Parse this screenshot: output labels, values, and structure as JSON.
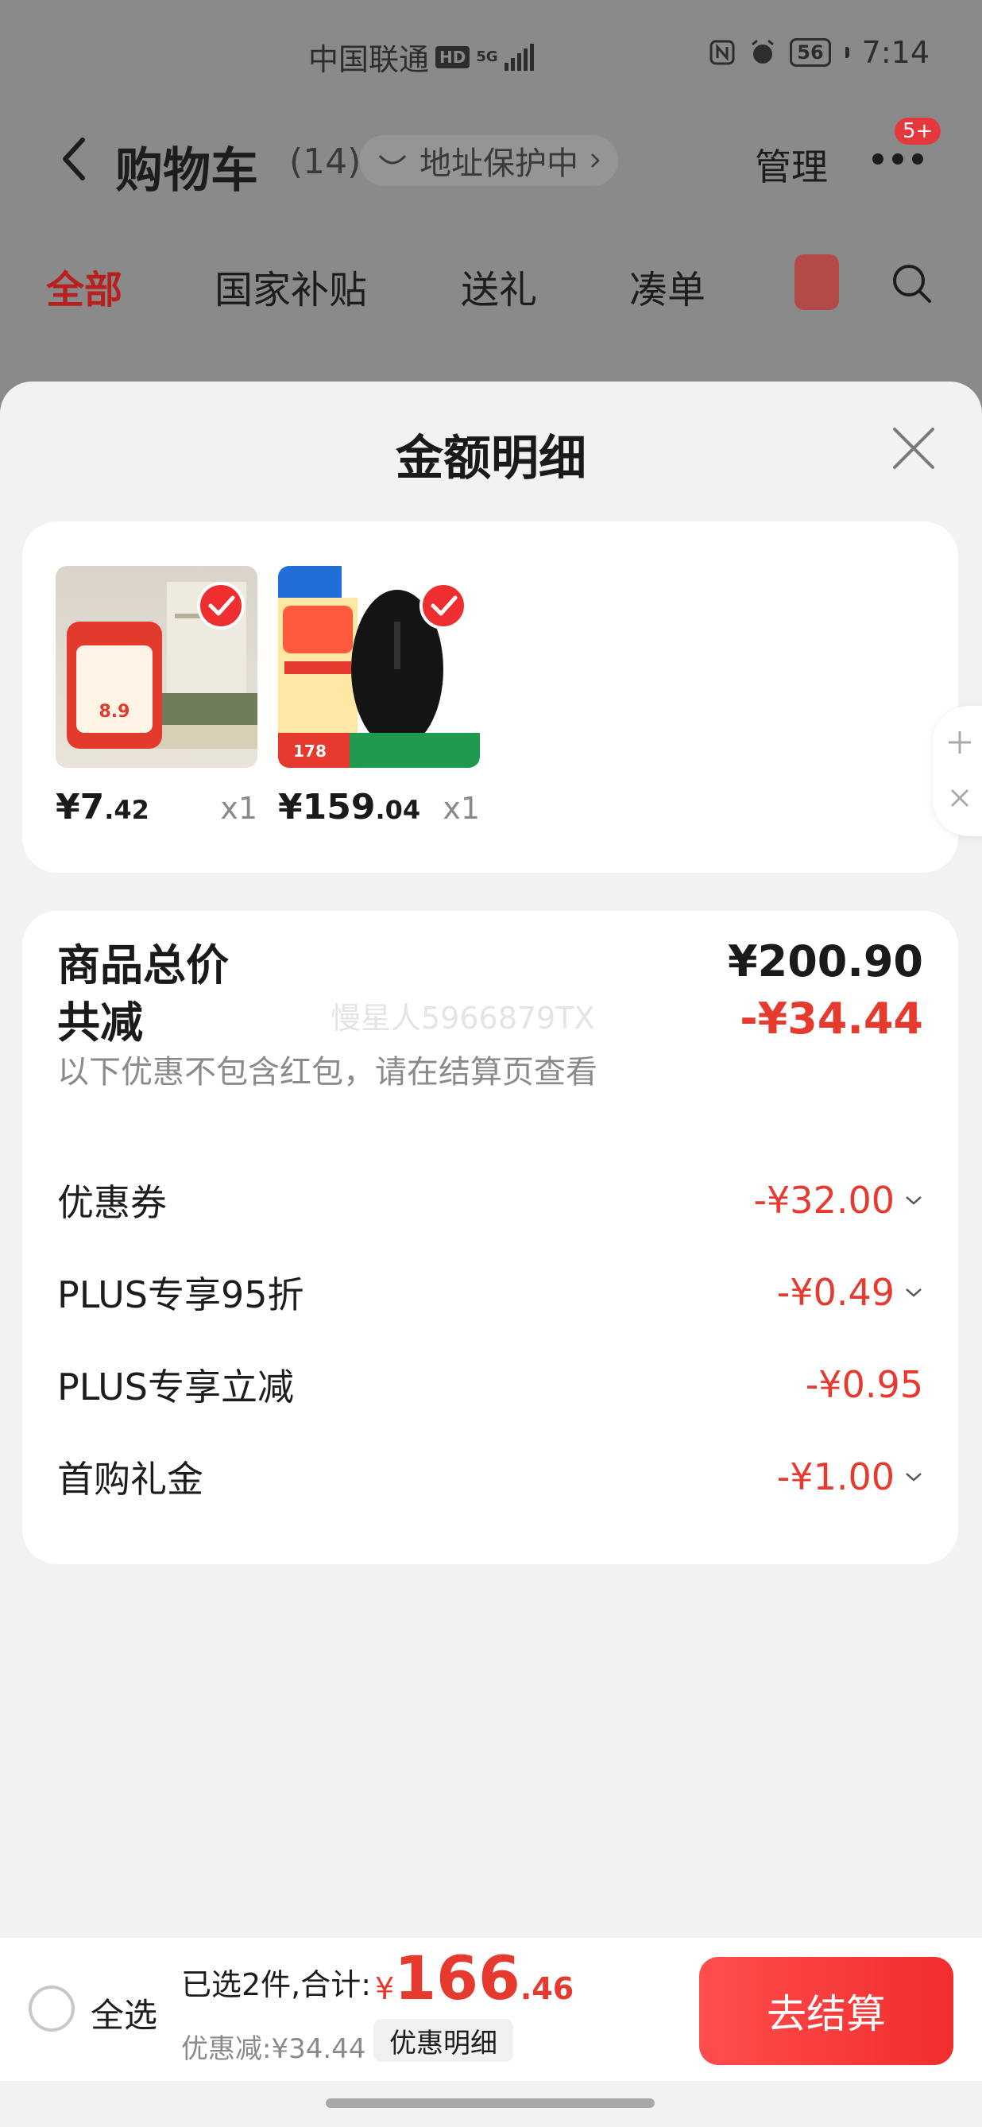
{
  "status_bar": {
    "carrier": "中国联通",
    "hd": "HD",
    "network": "5G",
    "battery": "56",
    "time": "7:14"
  },
  "nav": {
    "title": "购物车",
    "count": "(14)",
    "address_protect": "地址保护中",
    "manage": "管理",
    "more_badge": "5+"
  },
  "tabs": [
    {
      "label": "全部",
      "active": true
    },
    {
      "label": "国家补贴",
      "active": false
    },
    {
      "label": "送礼",
      "active": false
    },
    {
      "label": "凑单",
      "active": false
    }
  ],
  "sheet": {
    "title": "金额明细",
    "products": [
      {
        "name": "tea-bags",
        "price_int": "¥7",
        "price_dec": ".42",
        "qty": "x1",
        "selected": true
      },
      {
        "name": "logitech-mouse",
        "price_int": "¥159",
        "price_dec": ".04",
        "qty": "x1",
        "selected": true
      }
    ],
    "watermark": "慢星人5966879TX",
    "total_label": "商品总价",
    "total_value": "¥200.90",
    "reduce_label": "共减",
    "reduce_value": "-¥34.44",
    "reduce_note": "以下优惠不包含红包，请在结算页查看",
    "discounts": [
      {
        "label": "优惠券",
        "value": "-¥32.00",
        "expandable": true
      },
      {
        "label": "PLUS专享95折",
        "value": "-¥0.49",
        "expandable": true
      },
      {
        "label": "PLUS专享立减",
        "value": "-¥0.95",
        "expandable": false
      },
      {
        "label": "首购礼金",
        "value": "-¥1.00",
        "expandable": true
      }
    ]
  },
  "bottom": {
    "select_all": "全选",
    "summary": "已选2件,合计:",
    "currency": "¥",
    "total_int": "166",
    "total_dec": ".46",
    "discount_line": "优惠减:¥34.44",
    "detail_chip": "优惠明细",
    "checkout": "去结算"
  },
  "colors": {
    "accent_red": "#e63a2e",
    "button_red": "#f12d2d"
  }
}
